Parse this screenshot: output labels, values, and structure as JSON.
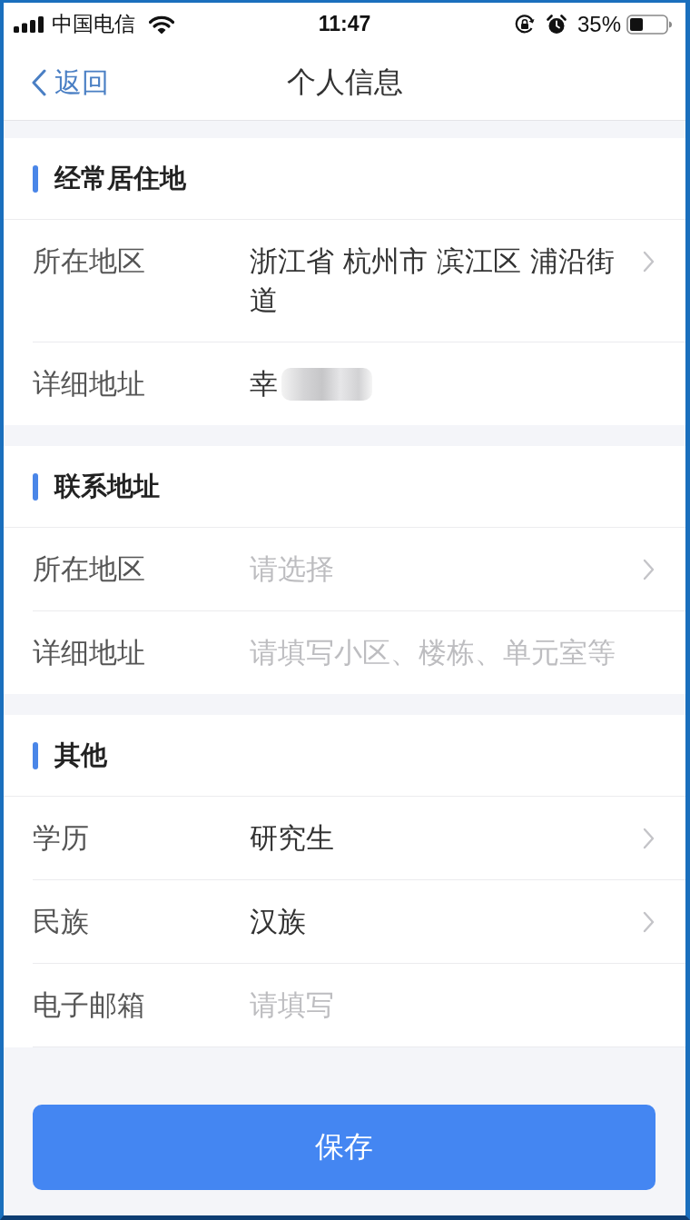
{
  "status_bar": {
    "carrier": "中国电信",
    "time": "11:47",
    "battery": "35%"
  },
  "nav_bar": {
    "back": "返回",
    "title": "个人信息"
  },
  "sections": [
    {
      "title": "经常居住地",
      "rows": [
        {
          "kind": "select",
          "label": "所在地区",
          "value": "浙江省 杭州市 滨江区 浦沿街道"
        },
        {
          "kind": "input",
          "label": "详细地址",
          "value": "幸",
          "redacted": true
        }
      ]
    },
    {
      "title": "联系地址",
      "rows": [
        {
          "kind": "select",
          "label": "所在地区",
          "placeholder": "请选择"
        },
        {
          "kind": "input",
          "label": "详细地址",
          "placeholder": "请填写小区、楼栋、单元室等"
        }
      ]
    },
    {
      "title": "其他",
      "rows": [
        {
          "kind": "select",
          "label": "学历",
          "value": "研究生"
        },
        {
          "kind": "select",
          "label": "民族",
          "value": "汉族"
        },
        {
          "kind": "input",
          "label": "电子邮箱",
          "placeholder": "请填写"
        }
      ]
    }
  ],
  "save_button": "保存"
}
